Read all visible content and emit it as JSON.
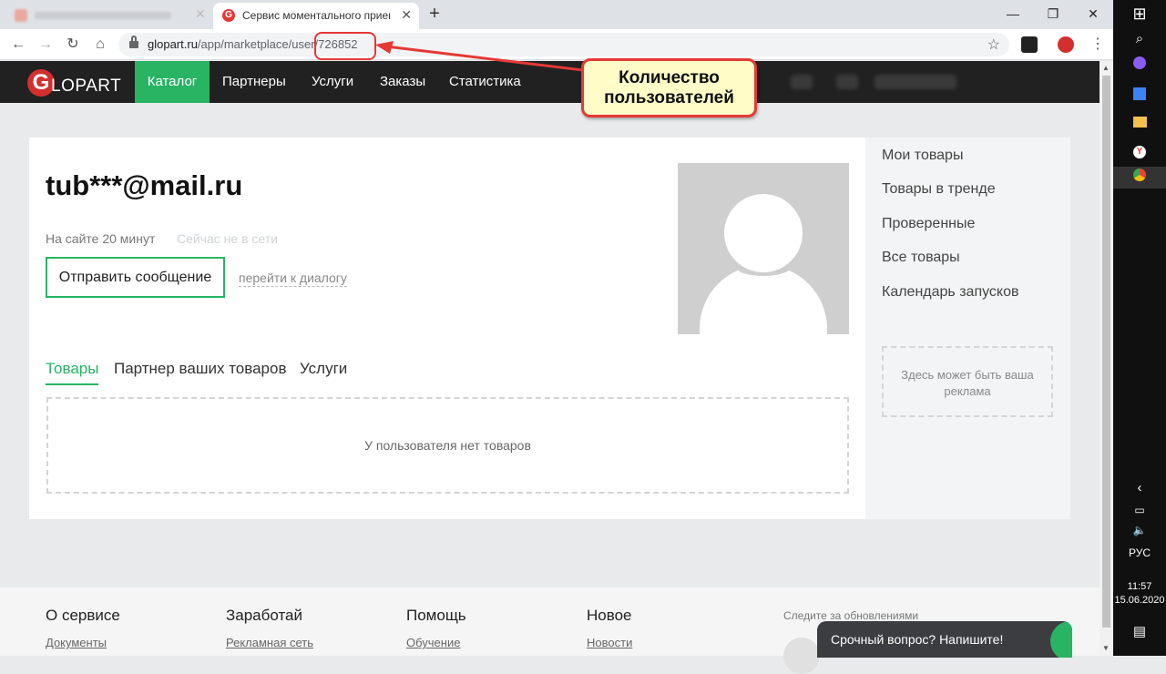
{
  "browser": {
    "active_tab_title": "Сервис моментального приема",
    "url_host": "glopart.ru",
    "url_path": "/app/marketplace/user/726852"
  },
  "annotation": {
    "line1": "Количество",
    "line2": "пользователей"
  },
  "header": {
    "logo_letter": "G",
    "logo_text": "LOPART",
    "nav": [
      "Каталог",
      "Партнеры",
      "Услуги",
      "Заказы",
      "Статистика"
    ]
  },
  "profile": {
    "email": "tub***@mail.ru",
    "online_time": "На сайте 20 минут",
    "status": "Сейчас не в сети",
    "send_message": "Отправить сообщение",
    "dialog_link": "перейти к диалогу",
    "tabs": [
      "Товары",
      "Партнер ваших товаров",
      "Услуги"
    ],
    "empty_text": "У пользователя нет товаров"
  },
  "sidebar": {
    "items": [
      "Мои товары",
      "Товары в тренде",
      "Проверенные",
      "Все товары",
      "Календарь запусков"
    ],
    "ad_text": "Здесь может быть ваша реклама"
  },
  "footer": {
    "columns": [
      {
        "title": "О сервисе",
        "link": "Документы"
      },
      {
        "title": "Заработай",
        "link": "Рекламная сеть"
      },
      {
        "title": "Помощь",
        "link": "Обучение"
      },
      {
        "title": "Новое",
        "link": "Новости"
      }
    ],
    "follow": "Следите за обновлениями"
  },
  "chat": {
    "text": "Срочный вопрос? Напишите!"
  },
  "taskbar": {
    "language": "РУС",
    "time": "11:57",
    "date": "15.06.2020"
  },
  "colors": {
    "accent": "#28b463",
    "header_bg": "#212121",
    "annotation_red": "#e53935",
    "annotation_fill": "#fffcc8"
  }
}
